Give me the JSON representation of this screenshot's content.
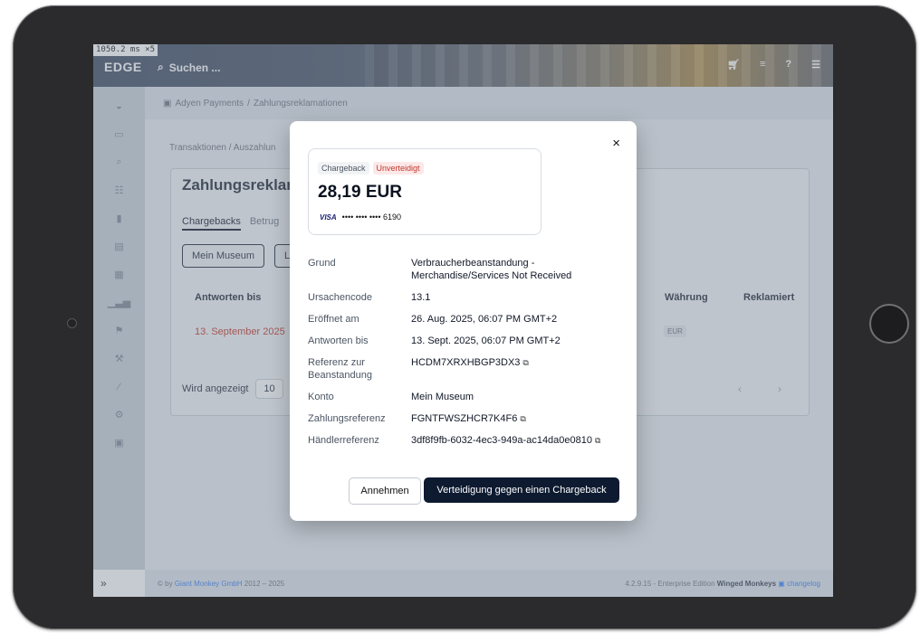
{
  "perf": "1050.2 ms ×5",
  "brand": "EDGE",
  "search": {
    "placeholder": "Suchen ..."
  },
  "top_icons": [
    "cart-icon",
    "terminal-icon",
    "help-icon",
    "language-icon"
  ],
  "sidebar_icons": [
    "dashboard-icon",
    "shop-icon",
    "search-icon",
    "cart-icon",
    "bookmark-icon",
    "id-card-icon",
    "calendar-icon",
    "chart-icon",
    "ticket-icon",
    "tools-icon",
    "wrench-icon",
    "gears-icon",
    "lock-icon"
  ],
  "sidebar_expand": "»",
  "breadcrumb": {
    "section": "Adyen Payments",
    "page": "Zahlungsreklamationen"
  },
  "sub_breadcrumb": {
    "a": "Transaktionen",
    "b": "Auszahlun"
  },
  "card": {
    "title": "Zahlungsreklam",
    "tabs": [
      "Chargebacks",
      "Betrug"
    ],
    "filters": [
      "Mein Museum",
      "L"
    ],
    "table": {
      "headers": [
        "Antworten bis",
        "Währung",
        "Reklamiert"
      ],
      "row": {
        "date": "13. September 2025",
        "currency": "EUR"
      }
    },
    "pager": {
      "label": "Wird angezeigt",
      "value": "10",
      "prev": "‹",
      "next": "›"
    }
  },
  "footer": {
    "left_prefix": "© by",
    "company": "Giant Monkey GmbH",
    "years": "2012 – 2025",
    "version": "4.2.9.15 - Enterprise Edition",
    "edition_name": "Winged Monkeys",
    "changelog": "changelog"
  },
  "modal": {
    "close": "×",
    "badge_type": "Chargeback",
    "badge_status": "Unverteidigt",
    "amount": "28,19 EUR",
    "card_brand": "VISA",
    "card_number": "•••• •••• •••• 6190",
    "details": [
      {
        "label": "Grund",
        "value": "Verbraucherbeanstandung - Merchandise/Services Not Received"
      },
      {
        "label": "Ursachencode",
        "value": "13.1"
      },
      {
        "label": "Eröffnet am",
        "value": "26. Aug. 2025, 06:07 PM GMT+2"
      },
      {
        "label": "Antworten bis",
        "value": "13. Sept. 2025, 06:07 PM GMT+2"
      },
      {
        "label": "Referenz zur Beanstandung",
        "value": "HCDM7XRXHBGP3DX3"
      },
      {
        "label": "Konto",
        "value": "Mein Museum"
      },
      {
        "label": "Zahlungsreferenz",
        "value": "FGNTFWSZHCR7K4F6"
      },
      {
        "label": "Händlerreferenz",
        "value": "3df8f9fb-6032-4ec3-949a-ac14da0e0810"
      }
    ],
    "accept_label": "Annehmen",
    "defend_label": "Verteidigung gegen einen Chargeback"
  },
  "colors": {
    "accent": "#0d1a30",
    "danger": "#c0392b",
    "link": "#3b82f6"
  }
}
